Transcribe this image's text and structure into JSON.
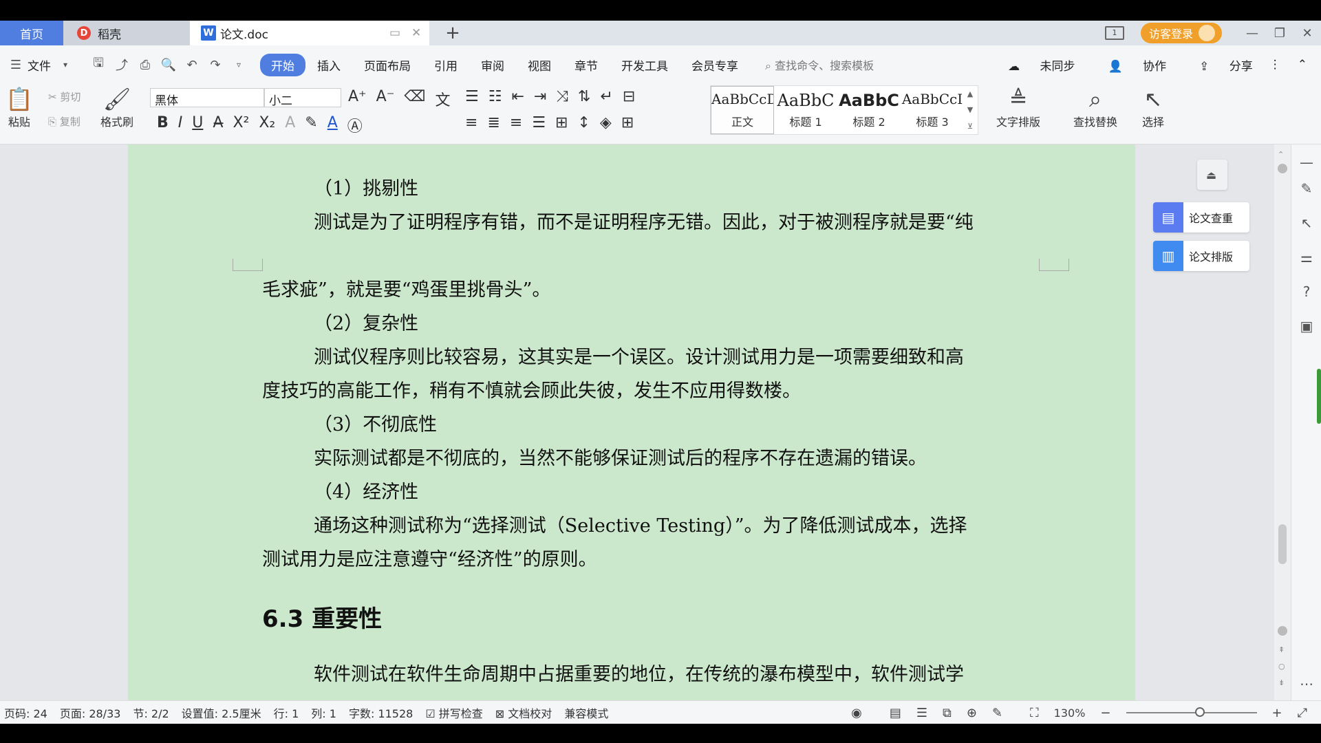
{
  "tabs": {
    "home": "首页",
    "daoke": "稻壳",
    "doc": "论文.doc",
    "add": "+"
  },
  "window": {
    "guest_login": "访客登录",
    "layout_num": "1"
  },
  "menu": {
    "file": "文件",
    "items": [
      "开始",
      "插入",
      "页面布局",
      "引用",
      "审阅",
      "视图",
      "章节",
      "开发工具",
      "会员专享"
    ],
    "search_placeholder": "查找命令、搜索模板",
    "unsync": "未同步",
    "collab": "协作",
    "share": "分享"
  },
  "ribbon": {
    "paste": "粘贴",
    "cut": "剪切",
    "copy": "复制",
    "format_painter": "格式刷",
    "font": "黑体",
    "size": "小二",
    "styles": [
      {
        "preview": "AaBbCcDd",
        "name": "正文"
      },
      {
        "preview": "AaBbC",
        "name": "标题 1"
      },
      {
        "preview": "AaBbC",
        "name": "标题 2"
      },
      {
        "preview": "AaBbCcI",
        "name": "标题 3"
      }
    ],
    "text_layout": "文字排版",
    "find_replace": "查找替换",
    "select": "选择"
  },
  "document": {
    "lines": [
      "（1）挑剔性",
      "测试是为了证明程序有错，而不是证明程序无错。因此，对于被测程序就是要“纯",
      "毛求疵”，就是要“鸡蛋里挑骨头”。",
      "（2）复杂性",
      "测试仪程序则比较容易，这其实是一个误区。设计测试用力是一项需要细致和高",
      "度技巧的高能工作，稍有不慎就会顾此失彼，发生不应用得数楼。",
      "（3）不彻底性",
      "实际测试都是不彻底的，当然不能够保证测试后的程序不存在遗漏的错误。",
      "（4）经济性",
      "通场这种测试称为“选择测试（Selective Testing）”。为了降低测试成本，选择",
      "测试用力是应注意遵守“经济性”的原则。",
      "软件测试在软件生命周期中占据重要的地位，在传统的瀑布模型中，软件测试学"
    ],
    "heading": "6.3 重要性"
  },
  "side_panel": {
    "check": "论文查重",
    "format": "论文排版"
  },
  "status": {
    "page_num": "页码: 24",
    "page": "页面: 28/33",
    "section": "节: 2/2",
    "setting": "设置值: 2.5厘米",
    "row": "行: 1",
    "col": "列: 1",
    "words": "字数: 11528",
    "spell": "拼写检查",
    "proof": "文档校对",
    "compat": "兼容模式",
    "zoom": "130%"
  }
}
